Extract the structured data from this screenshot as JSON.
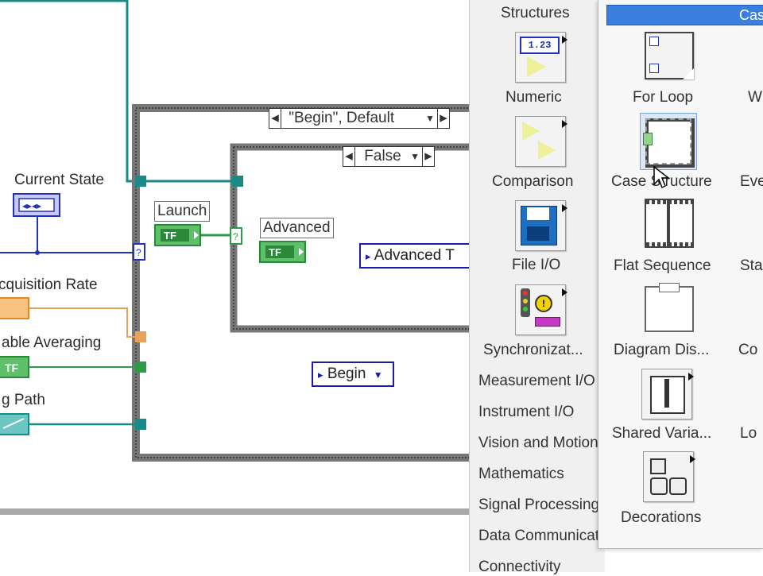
{
  "diagram": {
    "labels": {
      "current_state": "Current State",
      "acquisition_rate": "cquisition Rate",
      "enable_averaging": "able Averaging",
      "log_path": "g Path"
    },
    "nodes": {
      "launch": "Launch",
      "advanced": "Advanced",
      "bool_tf": "TF"
    },
    "case_outer_selector": "\"Begin\", Default",
    "case_inner_selector": "False",
    "enum_advanced": "Advanced T",
    "enum_begin": "Begin",
    "colors": {
      "wire_teal": "#1a8a88",
      "wire_blue": "#2233bb",
      "wire_orange": "#e8a15a",
      "wire_green": "#2f9a4a"
    }
  },
  "palette": {
    "categories": [
      {
        "label": "Structures",
        "icon": "structures-icon"
      },
      {
        "label": "Numeric",
        "icon": "numeric-icon"
      },
      {
        "label": "Comparison",
        "icon": "comparison-icon"
      },
      {
        "label": "File I/O",
        "icon": "file-io-icon"
      },
      {
        "label": "Synchronizat...",
        "icon": "synchronization-icon"
      }
    ],
    "list": [
      "Measurement I/O",
      "Instrument I/O",
      "Vision and Motion",
      "Mathematics",
      "Signal Processing",
      "Data Communication",
      "Connectivity"
    ],
    "subpalette_header": "Cas",
    "items": [
      {
        "label": "For Loop",
        "icon": "for-loop-icon"
      },
      {
        "label": "Case Structure",
        "icon": "case-structure-icon"
      },
      {
        "label": "Flat Sequence",
        "icon": "flat-sequence-icon"
      },
      {
        "label": "Diagram Dis...",
        "icon": "diagram-disable-icon"
      },
      {
        "label": "Shared Varia...",
        "icon": "shared-variable-icon"
      },
      {
        "label": "Decorations",
        "icon": "decorations-icon"
      }
    ],
    "right_edge_labels": [
      "W",
      "Eve",
      "Sta",
      "Co",
      "Lo"
    ]
  }
}
